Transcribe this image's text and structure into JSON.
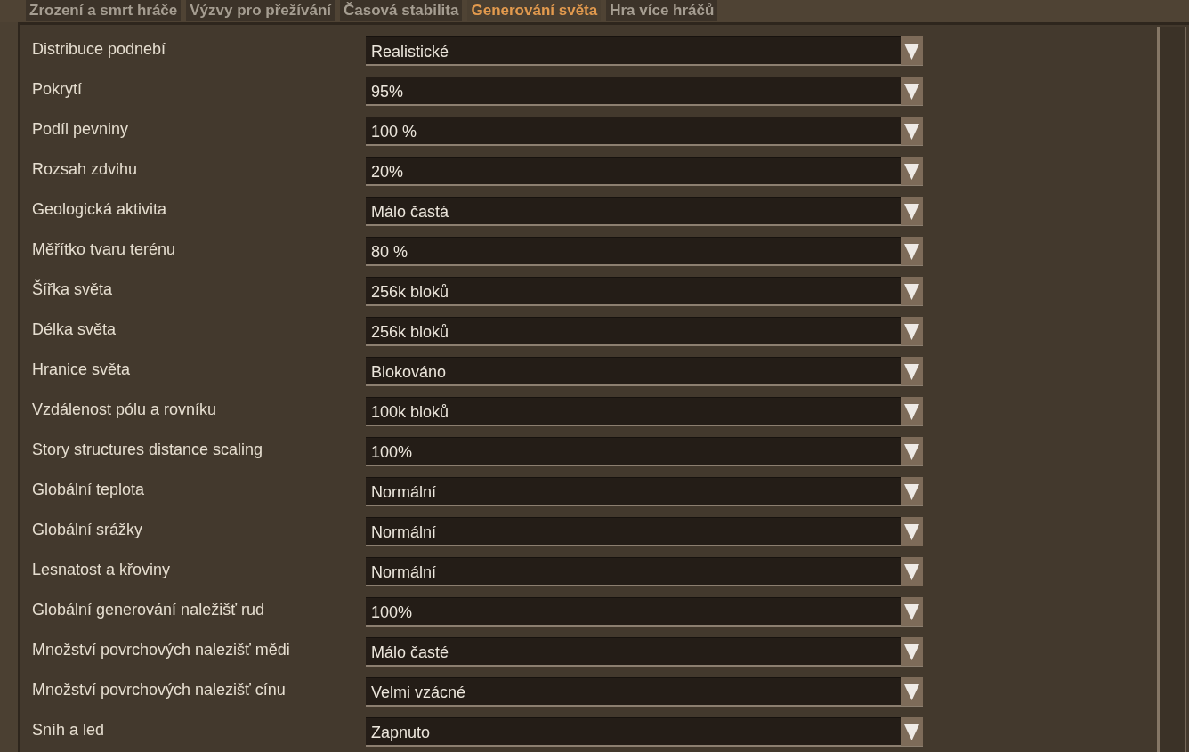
{
  "tabs": [
    {
      "label": "Zrození a smrt hráče",
      "selected": false
    },
    {
      "label": "Výzvy pro přežívání",
      "selected": false
    },
    {
      "label": "Časová stabilita",
      "selected": false
    },
    {
      "label": "Generování světa",
      "selected": true
    },
    {
      "label": "Hra více hráčů",
      "selected": false
    }
  ],
  "settings": [
    {
      "label": "Distribuce podnebí",
      "value": "Realistické"
    },
    {
      "label": "Pokrytí",
      "value": "95%"
    },
    {
      "label": "Podíl pevniny",
      "value": "100 %"
    },
    {
      "label": "Rozsah zdvihu",
      "value": "20%"
    },
    {
      "label": "Geologická aktivita",
      "value": "Málo častá"
    },
    {
      "label": "Měřítko tvaru terénu",
      "value": "80 %"
    },
    {
      "label": "Šířka světa",
      "value": "256k bloků"
    },
    {
      "label": "Délka světa",
      "value": "256k bloků"
    },
    {
      "label": "Hranice světa",
      "value": "Blokováno"
    },
    {
      "label": "Vzdálenost pólu a rovníku",
      "value": "100k bloků"
    },
    {
      "label": "Story structures distance scaling",
      "value": "100%"
    },
    {
      "label": "Globální teplota",
      "value": "Normální"
    },
    {
      "label": "Globální srážky",
      "value": "Normální"
    },
    {
      "label": "Lesnatost a křoviny",
      "value": "Normální"
    },
    {
      "label": "Globální generování naležišť rud",
      "value": "100%"
    },
    {
      "label": "Množství povrchových nalezišť mědi",
      "value": "Málo časté"
    },
    {
      "label": "Množství povrchových nalezišť cínu",
      "value": "Velmi vzácné"
    },
    {
      "label": "Sníh a led",
      "value": "Zapnuto"
    }
  ]
}
